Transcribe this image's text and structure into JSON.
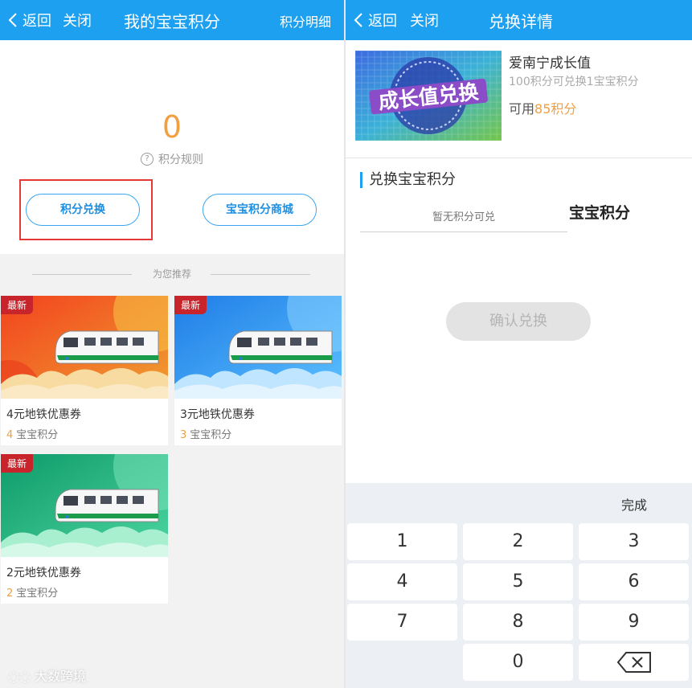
{
  "left": {
    "header": {
      "back_label": "返回",
      "close_label": "关闭",
      "title": "我的宝宝积分",
      "action_label": "积分明细"
    },
    "points": {
      "value": "0",
      "rules_label": "积分规则"
    },
    "buttons": {
      "exchange_label": "积分兑换",
      "mall_label": "宝宝积分商城"
    },
    "recommend": {
      "label": "为您推荐"
    },
    "cards": [
      {
        "badge": "最新",
        "name": "4元地铁优惠券",
        "price": "4",
        "unit": "宝宝积分",
        "theme": "red"
      },
      {
        "badge": "最新",
        "name": "3元地铁优惠券",
        "price": "3",
        "unit": "宝宝积分",
        "theme": "blue"
      },
      {
        "badge": "最新",
        "name": "2元地铁优惠券",
        "price": "2",
        "unit": "宝宝积分",
        "theme": "green"
      }
    ],
    "watermark": "大数跨境"
  },
  "right": {
    "header": {
      "back_label": "返回",
      "close_label": "关闭",
      "title": "兑换详情"
    },
    "product": {
      "image_text": "成长值兑换",
      "name": "爱南宁成长值",
      "rate": "100积分可兑换1宝宝积分",
      "available_prefix": "可用",
      "available_value": "85积分"
    },
    "exchange": {
      "title": "兑换宝宝积分",
      "input_placeholder": "暂无积分可兑",
      "unit": "宝宝积分",
      "confirm_label": "确认兑换"
    },
    "keyboard": {
      "done_label": "完成",
      "keys": [
        "1",
        "2",
        "3",
        "4",
        "5",
        "6",
        "7",
        "8",
        "9",
        "0"
      ]
    }
  },
  "colors": {
    "accent": "#1ea0f0",
    "points": "#f0a040",
    "badge": "#c8242b",
    "highlight": "#e53935"
  }
}
